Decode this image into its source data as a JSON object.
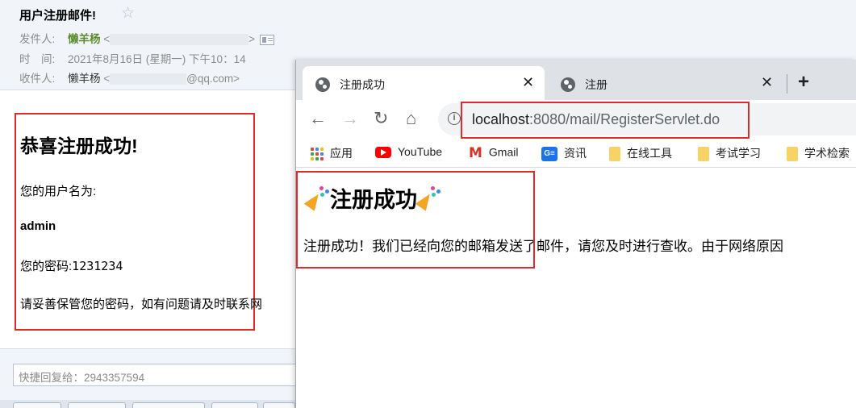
{
  "email": {
    "subject": "用户注册邮件!",
    "sender_label": "发件人:",
    "sender_name": "懒羊杨",
    "sender_open": "<",
    "sender_close": ">",
    "time_label": "时　间:",
    "time_value": "2021年8月16日 (星期一) 下午10：14",
    "recipient_label": "收件人:",
    "recipient_name": "懒羊杨",
    "recipient_open": "<",
    "recipient_domain": "@qq.com>",
    "body": {
      "title": "恭喜注册成功!",
      "username_label": "您的用户名为:",
      "username": "admin",
      "password_label": "您的密码:",
      "password": "1231234",
      "notice": "请妥善保管您的密码，如有问题请及时联系网"
    },
    "quick_reply_placeholder": "快捷回复给：2943357594"
  },
  "browser": {
    "tabs": [
      {
        "title": "注册成功",
        "close": "✕"
      },
      {
        "title": "注册",
        "close": "✕"
      }
    ],
    "new_tab": "+",
    "url_host": "localhost",
    "url_path": ":8080/mail/RegisterServlet.do",
    "nav": {
      "back": "←",
      "forward": "→",
      "reload": "↻",
      "home": "⌂",
      "info": "i"
    },
    "bookmarks": [
      "应用",
      "YouTube",
      "Gmail",
      "资讯",
      "在线工具",
      "考试学习",
      "学术检索"
    ],
    "news_icon_text": "G≡",
    "gmail_icon_text": "M",
    "page": {
      "title": "注册成功",
      "message": "注册成功！我们已经向您的邮箱发送了邮件，请您及时进行查收。由于网络原因"
    }
  },
  "colors": {
    "highlight_box": "#e02b2b",
    "sender_green": "#5b8d2f",
    "tabstrip": "#dee1e6"
  }
}
